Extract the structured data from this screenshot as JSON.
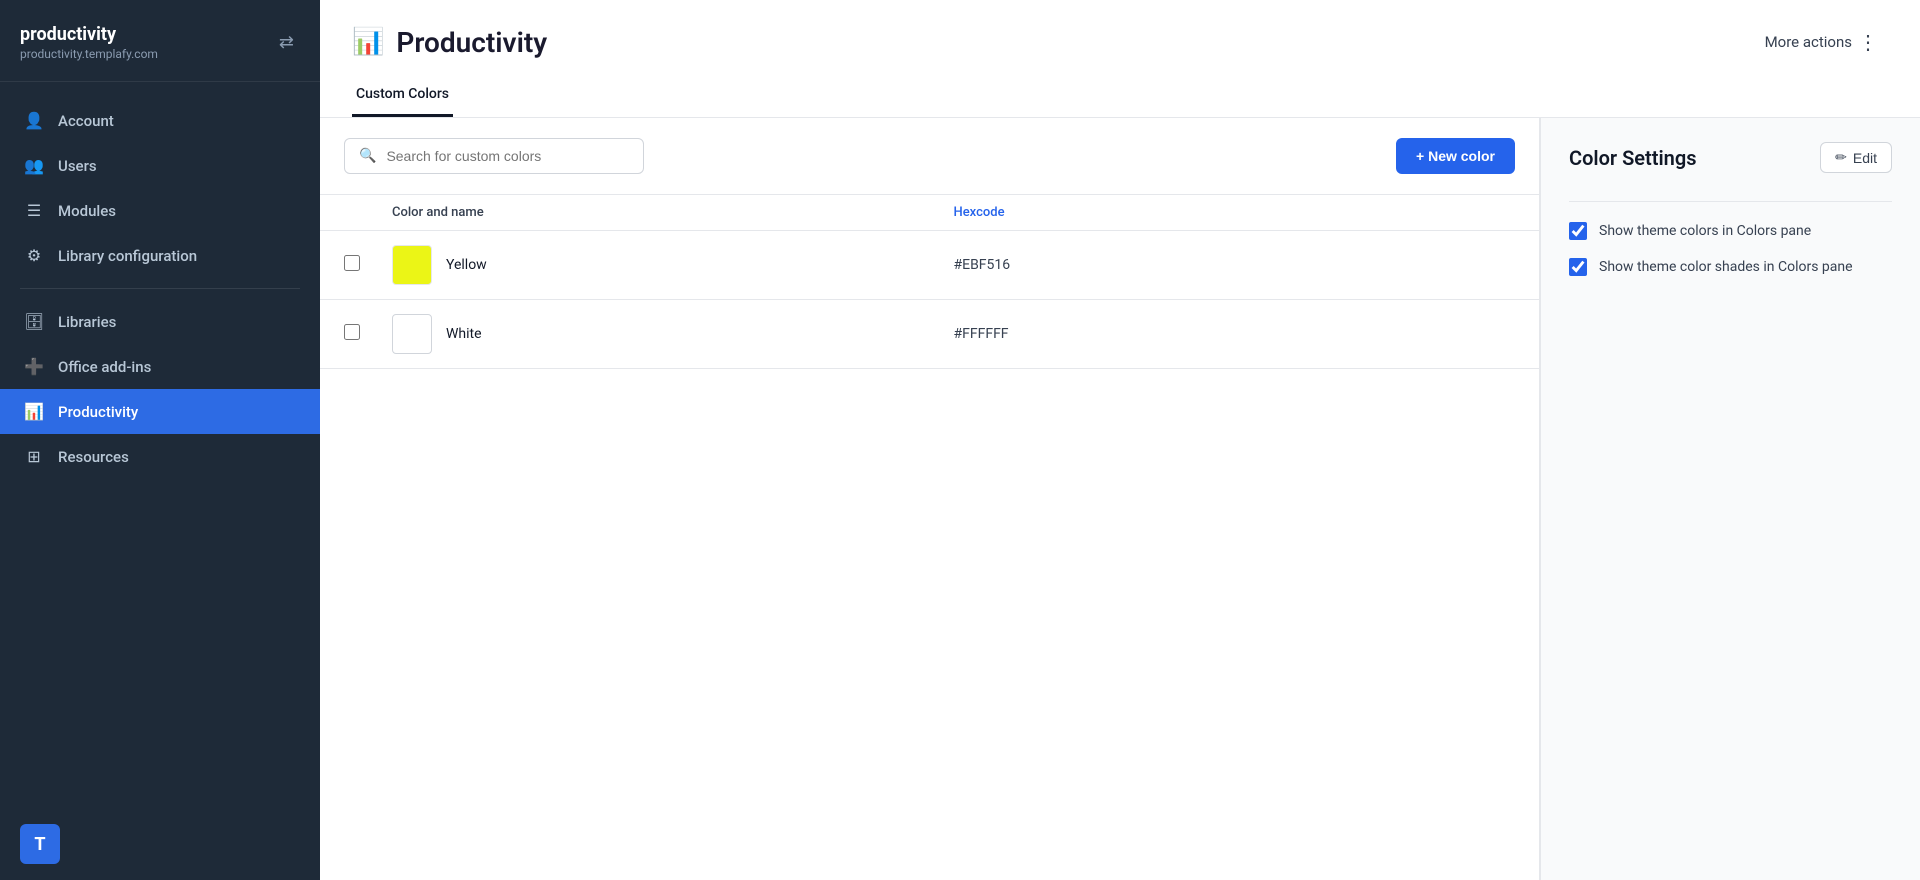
{
  "sidebar": {
    "brand": {
      "name": "productivity",
      "url": "productivity.templafy.com"
    },
    "nav_items": [
      {
        "id": "account",
        "label": "Account",
        "icon": "👤",
        "active": false
      },
      {
        "id": "users",
        "label": "Users",
        "icon": "👥",
        "active": false
      },
      {
        "id": "modules",
        "label": "Modules",
        "icon": "☰",
        "active": false
      },
      {
        "id": "library-configuration",
        "label": "Library configuration",
        "icon": "⚙",
        "active": false
      },
      {
        "id": "libraries",
        "label": "Libraries",
        "icon": "🗄",
        "active": false
      },
      {
        "id": "office-add-ins",
        "label": "Office add-ins",
        "icon": "➕",
        "active": false
      },
      {
        "id": "productivity",
        "label": "Productivity",
        "icon": "📊",
        "active": true
      },
      {
        "id": "resources",
        "label": "Resources",
        "icon": "⊞",
        "active": false
      }
    ],
    "user_avatar_label": "T"
  },
  "header": {
    "title": "Productivity",
    "more_actions_label": "More actions",
    "tabs": [
      {
        "id": "custom-colors",
        "label": "Custom Colors",
        "active": true
      }
    ]
  },
  "toolbar": {
    "search_placeholder": "Search for custom colors",
    "new_color_label": "+ New color"
  },
  "table": {
    "columns": [
      {
        "id": "color-name",
        "label": "Color and name"
      },
      {
        "id": "hexcode",
        "label": "Hexcode"
      }
    ],
    "rows": [
      {
        "id": "yellow",
        "name": "Yellow",
        "hex": "#EBF516",
        "swatch_color": "#EBF516",
        "border_color": "#ccc"
      },
      {
        "id": "white",
        "name": "White",
        "hex": "#FFFFFF",
        "swatch_color": "#FFFFFF",
        "border_color": "#d1d5db"
      }
    ]
  },
  "settings_panel": {
    "title": "Color Settings",
    "edit_label": "Edit",
    "settings": [
      {
        "id": "show-theme-colors",
        "label": "Show theme colors in Colors pane",
        "checked": true
      },
      {
        "id": "show-theme-color-shades",
        "label": "Show theme color shades in Colors pane",
        "checked": true
      }
    ]
  }
}
